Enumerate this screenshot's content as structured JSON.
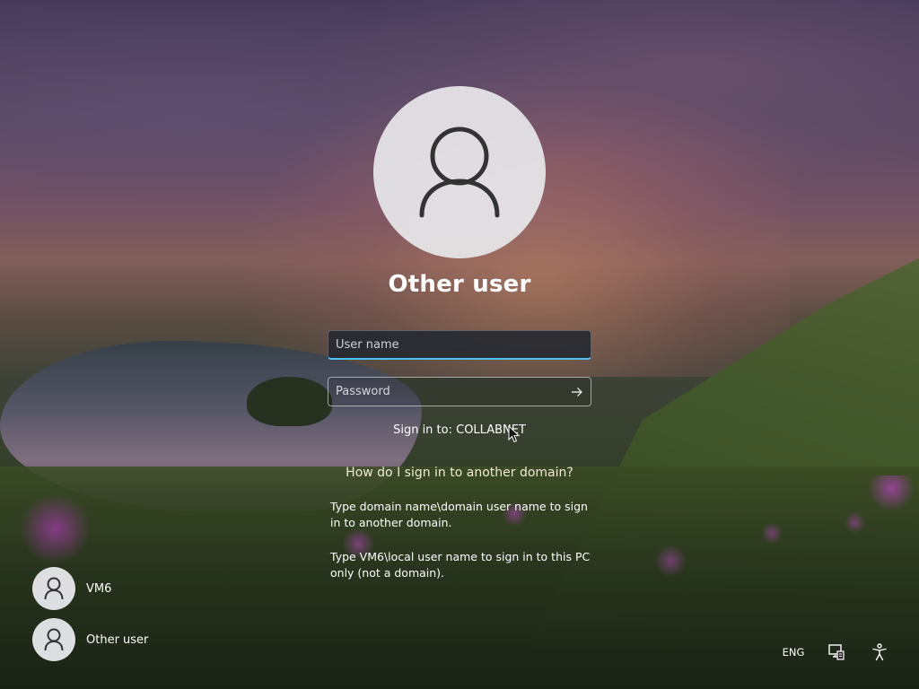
{
  "login": {
    "title": "Other user",
    "username_placeholder": "User name",
    "username_value": "",
    "password_placeholder": "Password",
    "password_value": "",
    "sign_in_to": "Sign in to: COLLABNET",
    "help_link": "How do I sign in to another domain?",
    "help_text_1": "Type domain name\\domain user name to sign in to another domain.",
    "help_text_2": "Type VM6\\local user name to sign in to this PC only (not a domain)."
  },
  "users": [
    {
      "name": "VM6",
      "icon": "user-icon"
    },
    {
      "name": "Other user",
      "icon": "user-icon"
    }
  ],
  "tray": {
    "language": "ENG",
    "network_icon": "network-icon",
    "accessibility_icon": "accessibility-icon"
  },
  "colors": {
    "focus_accent": "#4cc2ff",
    "avatar_bg": "#e8e8ec",
    "avatar_glyph": "#333333"
  }
}
